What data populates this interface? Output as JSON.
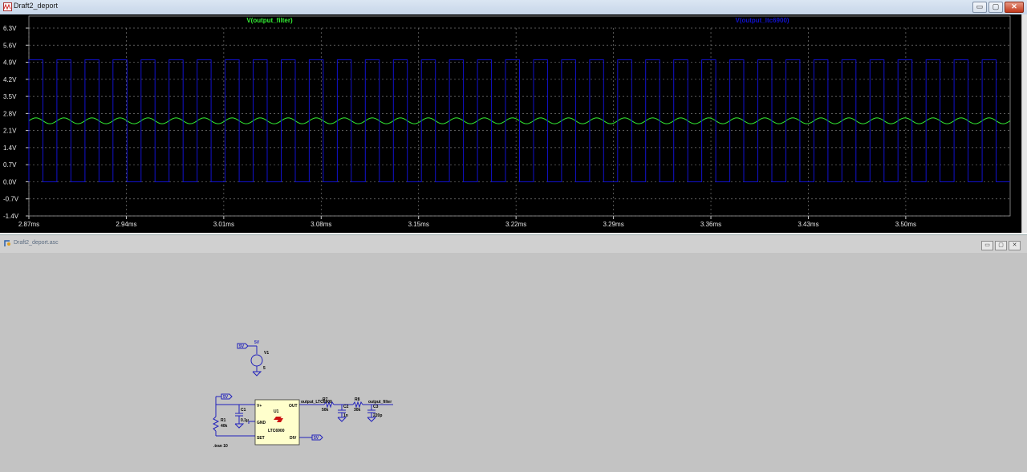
{
  "window_plot": {
    "title": "Draft2_deport",
    "buttons": {
      "minimize": "▭",
      "maximize": "▢",
      "close": "✕"
    }
  },
  "window_schematic": {
    "title": "Draft2_deport.asc",
    "buttons": {
      "minimize": "▭",
      "maximize": "▢",
      "close": "✕"
    }
  },
  "chart_data": {
    "type": "line",
    "title": "",
    "background": "#000000",
    "grid": true,
    "xlim": [
      2.87,
      3.575
    ],
    "ylim": [
      -1.4,
      6.3
    ],
    "y_ticks": [
      "6.3V",
      "5.6V",
      "4.9V",
      "4.2V",
      "3.5V",
      "2.8V",
      "2.1V",
      "1.4V",
      "0.7V",
      "0.0V",
      "-0.7V",
      "-1.4V"
    ],
    "x_ticks": [
      "2.87ms",
      "2.94ms",
      "3.01ms",
      "3.08ms",
      "3.15ms",
      "3.22ms",
      "3.29ms",
      "3.36ms",
      "3.43ms",
      "3.50ms"
    ],
    "series": [
      {
        "name": "V(output_filter)",
        "color": "#33ee33",
        "shape": "sine",
        "center": 2.5,
        "amplitude": 0.12,
        "cycles": 35
      },
      {
        "name": "V(output_ltc6900)",
        "color": "#1111cc",
        "shape": "square",
        "low": 0.0,
        "high": 5.0,
        "cycles": 35
      }
    ]
  },
  "schematic": {
    "source_label": "5V",
    "v1_top": "5V",
    "v1_name": "V1",
    "v1_value": "5",
    "vplus_label": "5V",
    "u1_name": "U1",
    "u1_part": "LTC6900",
    "pin_vplus": "V+",
    "pin_gnd": "GND",
    "pin_set": "SET",
    "pin_out": "OUT",
    "pin_div": "DIV",
    "div_label": "5V",
    "c1_name": "C1",
    "c1_value": "0.1µ",
    "r1_name": "R1",
    "r1_value": "40k",
    "net_out": "output_LTC6900",
    "r7_name": "R7",
    "r7_value": "50k",
    "c_mid_name": "C2",
    "c_mid_value": "1n",
    "r8_name": "R8",
    "r8_value": "30k",
    "net_filter": "output_filter",
    "c_out_name": "C3",
    "c_out_value": "220p",
    "directive": ".tran 10"
  }
}
